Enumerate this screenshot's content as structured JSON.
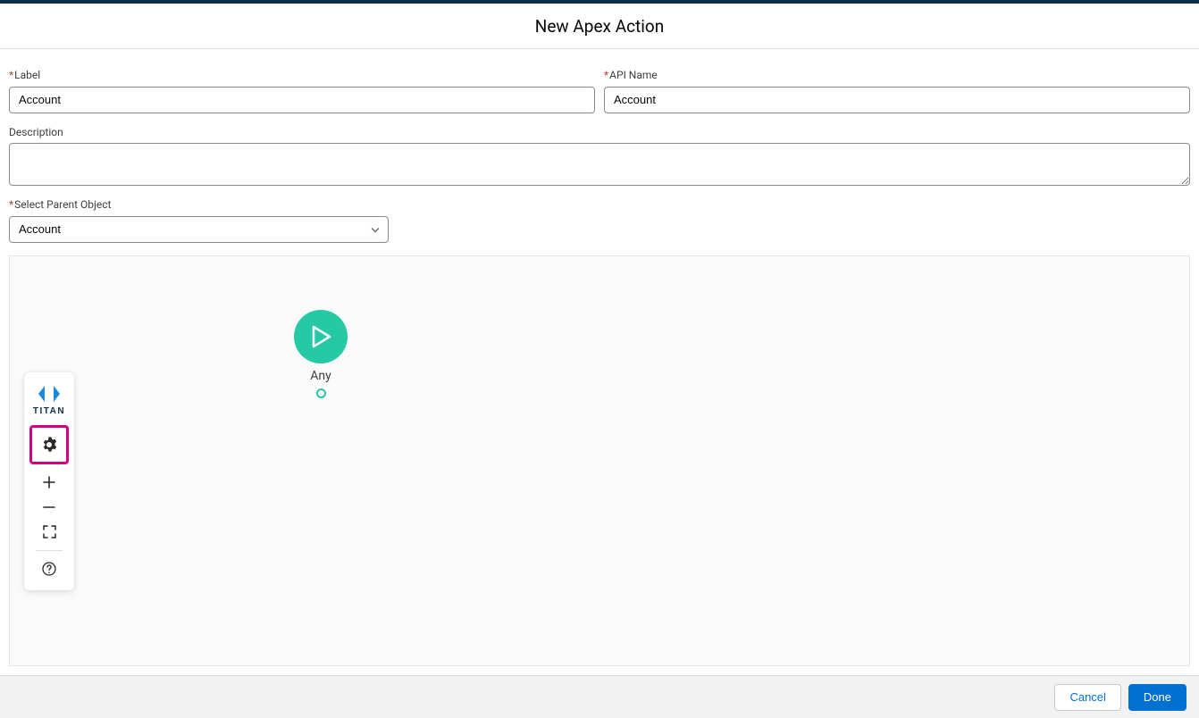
{
  "header": {
    "title": "New Apex Action"
  },
  "form": {
    "label_field_label": "Label",
    "label_value": "Account",
    "api_name_label": "API Name",
    "api_name_value": "Account",
    "description_label": "Description",
    "description_value": "",
    "parent_object_label": "Select Parent Object",
    "parent_object_value": "Account"
  },
  "canvas": {
    "start_node_label": "Any"
  },
  "toolbar": {
    "brand": "TITAN"
  },
  "footer": {
    "cancel": "Cancel",
    "done": "Done"
  }
}
